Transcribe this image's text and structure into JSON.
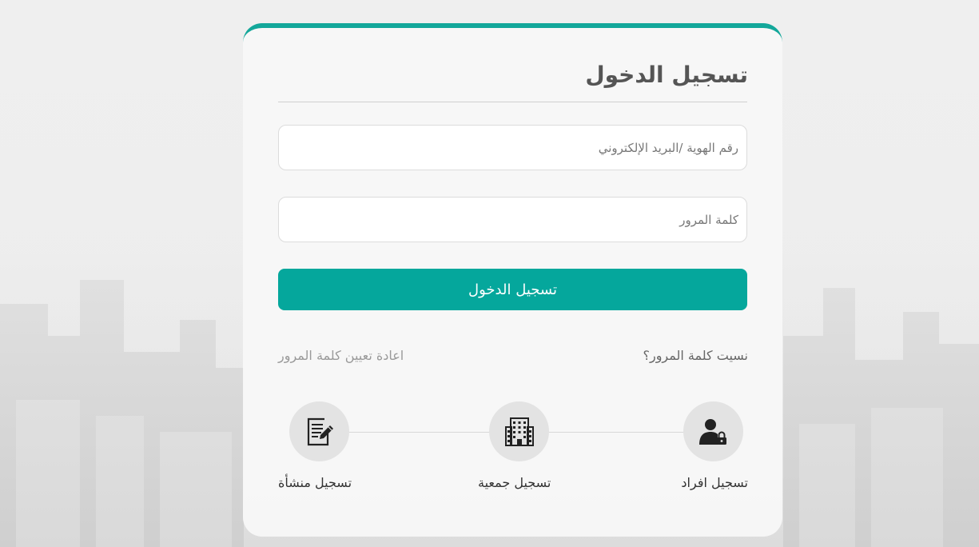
{
  "login": {
    "title": "تسجيل الدخول",
    "id_placeholder": "رقم الهوية /البريد الإلكتروني",
    "password_placeholder": "كلمة المرور",
    "submit_label": "تسجيل الدخول",
    "forgot_password": "نسيت كلمة المرور؟",
    "reset_password": "اعادة تعيين كلمة المرور"
  },
  "registration": [
    {
      "label": "تسجيل افراد",
      "icon": "user-lock-icon"
    },
    {
      "label": "تسجيل جمعية",
      "icon": "building-icon"
    },
    {
      "label": "تسجيل منشأة",
      "icon": "document-edit-icon"
    }
  ],
  "colors": {
    "accent": "#05a79c",
    "card_top_border": "#13a79a"
  }
}
